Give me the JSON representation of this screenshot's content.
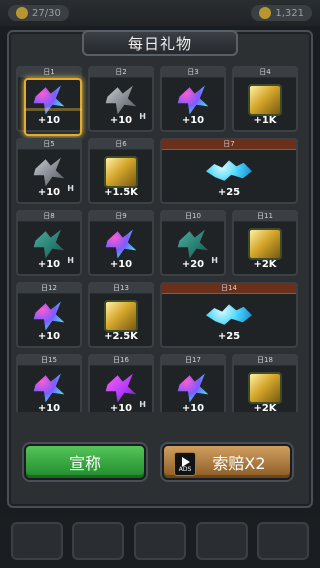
{
  "topbar": {
    "left_text": "27/30",
    "right_text": "1,321"
  },
  "dialog": {
    "title": "每日礼物"
  },
  "rewards": [
    {
      "day": "日1",
      "type": "holo",
      "qty": "+10",
      "highlight": true
    },
    {
      "day": "日2",
      "type": "gray",
      "qty": "+10",
      "badge": "H"
    },
    {
      "day": "日3",
      "type": "holo",
      "qty": "+10"
    },
    {
      "day": "日4",
      "type": "gold",
      "qty": "+1K"
    },
    {
      "day": "日5",
      "type": "gray",
      "qty": "+10",
      "badge": "H"
    },
    {
      "day": "日6",
      "type": "gold",
      "qty": "+1.5K"
    },
    {
      "day": "日7",
      "type": "gems",
      "qty": "+25",
      "wide": true
    },
    {
      "day": "日8",
      "type": "green",
      "qty": "+10",
      "badge": "H"
    },
    {
      "day": "日9",
      "type": "holo",
      "qty": "+10"
    },
    {
      "day": "日10",
      "type": "green",
      "qty": "+20",
      "badge": "H"
    },
    {
      "day": "日11",
      "type": "gold",
      "qty": "+2K"
    },
    {
      "day": "日12",
      "type": "holo",
      "qty": "+10"
    },
    {
      "day": "日13",
      "type": "gold",
      "qty": "+2.5K"
    },
    {
      "day": "日14",
      "type": "gems",
      "qty": "+25",
      "wide": true
    },
    {
      "day": "日15",
      "type": "holo",
      "qty": "+10"
    },
    {
      "day": "日16",
      "type": "purple",
      "qty": "+10",
      "badge": "H"
    },
    {
      "day": "日17",
      "type": "holo",
      "qty": "+10"
    },
    {
      "day": "日18",
      "type": "gold",
      "qty": "+2K"
    }
  ],
  "buttons": {
    "claim": "宣称",
    "double": "索赔X2",
    "ads_label": "ADS"
  }
}
